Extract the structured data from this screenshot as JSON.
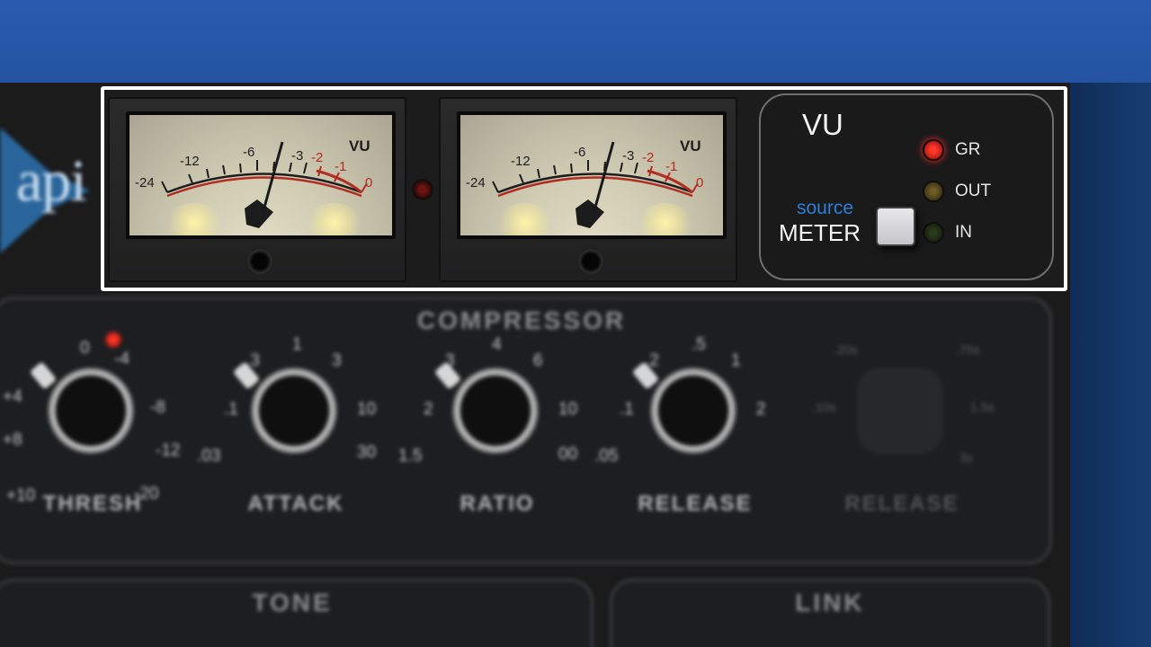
{
  "plugin": {
    "brand": "api",
    "led_colors": {
      "gr": "#ff2a20",
      "out": "#5a4b1a",
      "in": "#1e2a12"
    }
  },
  "meters": {
    "scale": [
      "-24",
      "-12",
      "-6",
      "-3",
      "-2",
      "-1",
      "0"
    ],
    "unit": "VU"
  },
  "source_panel": {
    "title": "VU",
    "label_source": "source",
    "label_meter": "METER",
    "indicators": [
      {
        "label": "GR",
        "active": true
      },
      {
        "label": "OUT",
        "active": false
      },
      {
        "label": "IN",
        "active": false
      }
    ]
  },
  "compressor": {
    "title": "COMPRESSOR",
    "knobs": [
      {
        "label": "THRESH",
        "ticks": [
          "0",
          "-4",
          "+4",
          "-8",
          "+8",
          "-12",
          "+10",
          "-20"
        ]
      },
      {
        "label": "ATTACK",
        "ticks": [
          "1",
          ".3",
          "3",
          ".1",
          "10",
          ".03",
          "30"
        ]
      },
      {
        "label": "RATIO",
        "ticks": [
          "4",
          "3",
          "6",
          "2",
          "10",
          "1.5",
          "00"
        ]
      },
      {
        "label": "RELEASE",
        "ticks": [
          ".5",
          ".2",
          "1",
          ".1",
          "2",
          ".05"
        ]
      }
    ],
    "release_ticks": [
      ".20s",
      ".75s",
      ".10s",
      "1.5s",
      "3s"
    ],
    "release_title": "RELEASE"
  },
  "bottom": {
    "tone": "TONE",
    "link": "LINK"
  }
}
